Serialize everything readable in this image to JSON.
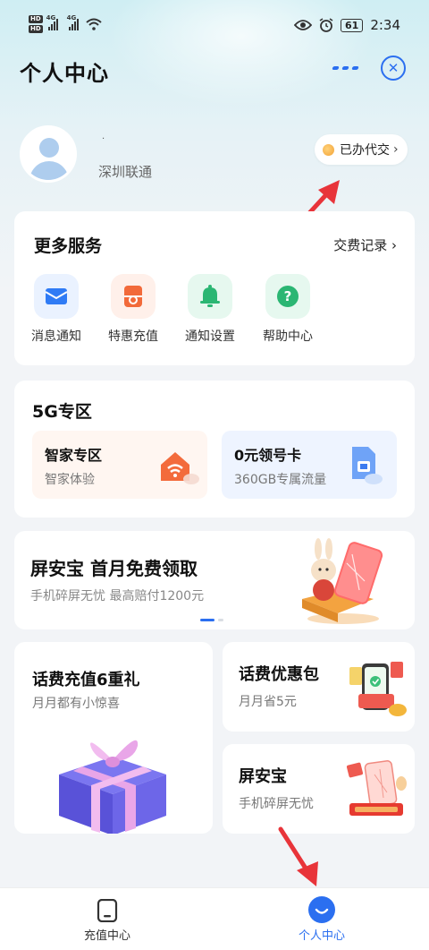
{
  "status_bar": {
    "network_1": "4G",
    "network_2": "4G",
    "hd_1": "HD",
    "hd_2": "HD",
    "battery": "61",
    "time": "2:34"
  },
  "header": {
    "title": "个人中心",
    "menu_icon": "more-dots-icon",
    "close_icon": "close-x-icon",
    "accent": "#2b6ff0"
  },
  "profile": {
    "username": "·",
    "carrier": "深圳联通",
    "paid_badge": "已办代交"
  },
  "services": {
    "title": "更多服务",
    "more_link": "交费记录",
    "items": [
      {
        "label": "消息通知",
        "icon": "envelope-icon"
      },
      {
        "label": "特惠充值",
        "icon": "recharge-icon"
      },
      {
        "label": "通知设置",
        "icon": "bell-icon"
      },
      {
        "label": "帮助中心",
        "icon": "question-icon"
      }
    ]
  },
  "zone5g": {
    "title": "5G专区",
    "cards": [
      {
        "title": "智家专区",
        "subtitle": "智家体验",
        "icon": "smart-home-wifi-icon"
      },
      {
        "title": "0元领号卡",
        "subtitle": "360GB专属流量",
        "icon": "sim-card-icon"
      }
    ]
  },
  "banner": {
    "title": "屏安宝 首月免费领取",
    "subtitle": "手机碎屏无忧 最高赔付1200元",
    "pages": 2,
    "active_page": 1
  },
  "promos": [
    {
      "title": "话费充值6重礼",
      "subtitle": "月月都有小惊喜"
    },
    {
      "title": "话费优惠包",
      "subtitle": "月月省5元"
    },
    {
      "title": "屏安宝",
      "subtitle": "手机碎屏无忧"
    }
  ],
  "bottom_nav": [
    {
      "label": "充值中心",
      "icon": "phone-recharge-icon",
      "active": false
    },
    {
      "label": "个人中心",
      "icon": "smile-user-icon",
      "active": true
    }
  ]
}
